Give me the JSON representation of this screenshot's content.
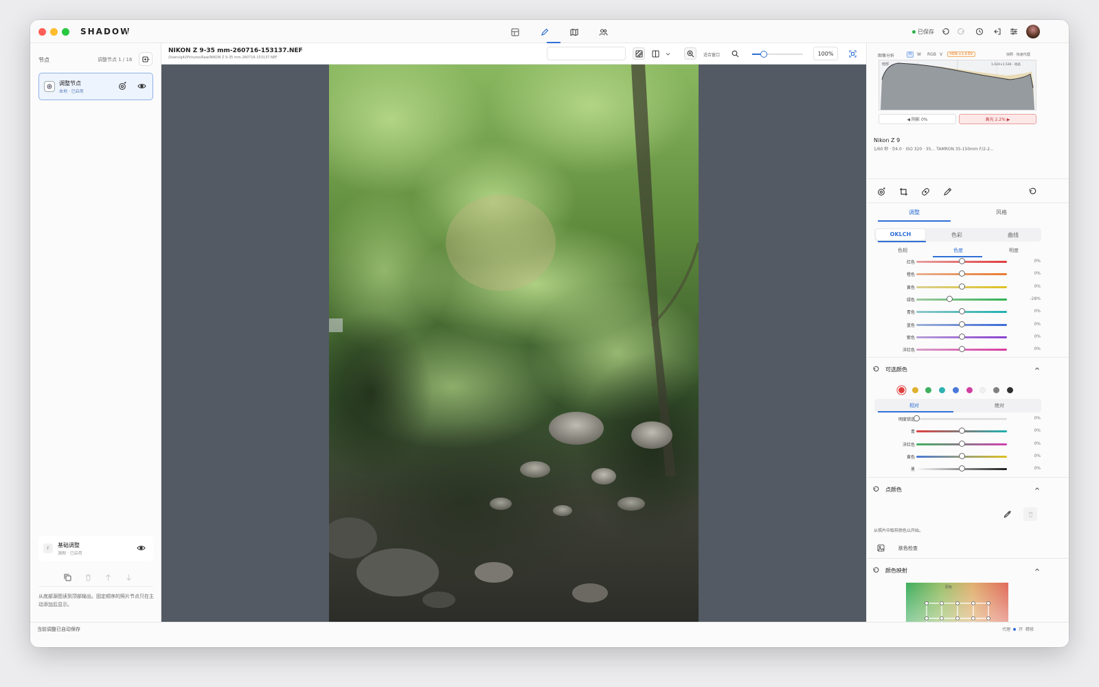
{
  "app": {
    "brand": "SHADOW",
    "saved_status": "已保存"
  },
  "colors": {
    "accent": "#2f6fd6",
    "traffic_red": "#ff5f57",
    "traffic_yellow": "#febc2e",
    "traffic_green": "#28c840",
    "canvas_bg": "#535a63"
  },
  "modes": [
    {
      "name": "library",
      "icon": "grid-icon"
    },
    {
      "name": "edit",
      "icon": "pencil-icon",
      "active": true
    },
    {
      "name": "map",
      "icon": "map-icon"
    },
    {
      "name": "people",
      "icon": "people-icon"
    }
  ],
  "left_panel": {
    "title": "节点",
    "node_count": "调整节点 1 / 16",
    "node": {
      "title": "调整节点",
      "subtitle": "本地 · 已启用"
    },
    "base": {
      "badge": "F",
      "title": "基础调整",
      "subtitle": "源图 · 已启用"
    },
    "help": "从底部源图读到顶部输出。固定顺序的照片节点只在主动添加后显示。"
  },
  "file": {
    "name": "NIKON Z 9-35 mm-260716-153137.NEF",
    "path": "/Users/g4i/Pictures/Raw/NIKON Z 9-35 mm-260716-153137.NEF"
  },
  "viewer": {
    "fit_label": "适合窗口",
    "zoom": "100%",
    "zoom_slider": 0.2
  },
  "histogram": {
    "header_left": "图像分析",
    "channels": [
      "H",
      "W",
      "RGB",
      "V"
    ],
    "hdr_badge": "HDR +1.9 EV",
    "header_right": "快照 · 快速代理",
    "label_left": "暗部",
    "label_right": "1,024×1,536 · 动态",
    "shadow_btn": "◀ 阴影  0%",
    "highlight_btn": "高光  2.2% ▶"
  },
  "camera": {
    "model": "Nikon Z 9",
    "exif": "1/60 秒  ·  f/4.0  ·  ISO 320  ·  35...  TAMRON 35-150mm F/2-2..."
  },
  "tabs": {
    "adjust": "调整",
    "style": "风格"
  },
  "oklch": {
    "modes": [
      "OKLCH",
      "色彩",
      "曲线"
    ],
    "subtabs": [
      "色相",
      "色度",
      "明度"
    ],
    "sliders": [
      {
        "label": "红色",
        "value": "0%",
        "pos": 0.5,
        "grad": "linear-gradient(90deg,#e8a0a0,#e03a3a)"
      },
      {
        "label": "橙色",
        "value": "0%",
        "pos": 0.5,
        "grad": "linear-gradient(90deg,#e8b090,#e87a30)"
      },
      {
        "label": "黄色",
        "value": "0%",
        "pos": 0.5,
        "grad": "linear-gradient(90deg,#d8cf90,#e0c020)"
      },
      {
        "label": "绿色",
        "value": "-28%",
        "pos": 0.37,
        "grad": "linear-gradient(90deg,#a0c8a0,#30b050)"
      },
      {
        "label": "青色",
        "value": "0%",
        "pos": 0.5,
        "grad": "linear-gradient(90deg,#90c8c8,#20b0b0)"
      },
      {
        "label": "蓝色",
        "value": "0%",
        "pos": 0.5,
        "grad": "linear-gradient(90deg,#a0b0d8,#3a6ad8)"
      },
      {
        "label": "紫色",
        "value": "0%",
        "pos": 0.5,
        "grad": "linear-gradient(90deg,#b8a0d8,#8a40d0)"
      },
      {
        "label": "洋红色",
        "value": "0%",
        "pos": 0.5,
        "grad": "linear-gradient(90deg,#d8a0c8,#d83aa0)"
      }
    ]
  },
  "selective": {
    "title": "可选颜色",
    "swatches": [
      "#e04040",
      "#e0b030",
      "#40b060",
      "#30b0b0",
      "#4a78d8",
      "#d040a0",
      "#f0f0f0",
      "#808080",
      "#303030"
    ],
    "modes": [
      "相对",
      "绝对"
    ],
    "sliders": [
      {
        "label": "明度锁定",
        "value": "0%",
        "pos": 0.0,
        "grad": "linear-gradient(90deg,#e0e0e0,#e0e0e0)"
      },
      {
        "label": "青",
        "value": "0%",
        "pos": 0.5,
        "grad": "linear-gradient(90deg,#e04040,#20b0b0)"
      },
      {
        "label": "洋红色",
        "value": "0%",
        "pos": 0.5,
        "grad": "linear-gradient(90deg,#40b060,#d040b0)"
      },
      {
        "label": "黄色",
        "value": "0%",
        "pos": 0.5,
        "grad": "linear-gradient(90deg,#4a78d8,#e0c020)"
      },
      {
        "label": "黑",
        "value": "0%",
        "pos": 0.5,
        "grad": "linear-gradient(90deg,#fafafa,#202020)"
      }
    ]
  },
  "point_color": {
    "title": "点颜色",
    "hint": "从照片中取样颜色以开始。",
    "skin_check": "肤色检查"
  },
  "color_map": {
    "title": "颜色映射",
    "inner_label": "原色"
  },
  "status": {
    "left": "当前调整已自动保存",
    "proxy_label": "代理",
    "proxy_on": "开",
    "proxy_right": "精修"
  }
}
